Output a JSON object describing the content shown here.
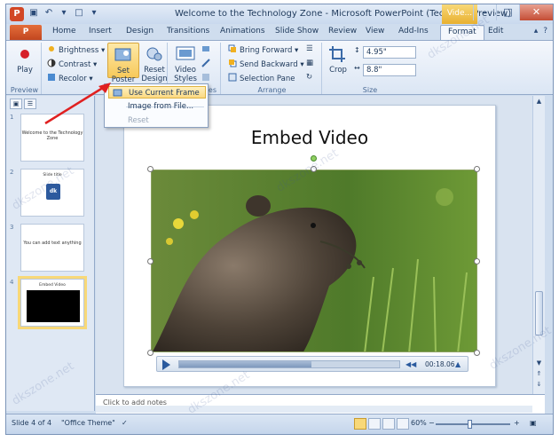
{
  "window": {
    "title": "Welcome to the Technology Zone - Microsoft PowerPoint (Technical Preview)",
    "context_tab": "Vide..."
  },
  "tabs": [
    "Home",
    "Insert",
    "Design",
    "Transitions",
    "Animations",
    "Slide Show",
    "Review",
    "View",
    "Add-Ins",
    "Format",
    "Edit"
  ],
  "file_tab": "P",
  "active_tab": "Format",
  "ribbon": {
    "preview": {
      "play_label": "Play",
      "group_label": "Preview"
    },
    "adjust": {
      "brightness": "Brightness",
      "contrast": "Contrast",
      "recolor": "Recolor",
      "set_poster_frame": "Set Poster Frame",
      "reset_design": "Reset Design"
    },
    "styles": {
      "video_styles": "Video Styles",
      "group_label": "les"
    },
    "arrange": {
      "bring_forward": "Bring Forward",
      "send_backward": "Send Backward",
      "selection_pane": "Selection Pane",
      "group_label": "Arrange"
    },
    "size": {
      "crop": "Crop",
      "height": "4.95\"",
      "width": "8.8\"",
      "group_label": "Size"
    }
  },
  "dropdown": {
    "items": [
      "Use Current Frame",
      "Image from File...",
      "Reset"
    ]
  },
  "slides": [
    {
      "num": "1",
      "text": "Welcome to the Technology Zone"
    },
    {
      "num": "2",
      "title": "Slide title",
      "logo": "dk"
    },
    {
      "num": "3",
      "text": "You can add text anything"
    },
    {
      "num": "4",
      "title": "Embed Video"
    }
  ],
  "slide": {
    "title": "Embed Video",
    "video_time": "00:18.06",
    "progress_fraction": 0.6
  },
  "notes": {
    "placeholder": "Click to add notes"
  },
  "status": {
    "slide": "Slide 4 of 4",
    "theme": "\"Office Theme\"",
    "zoom": "60%"
  },
  "watermark": "dkszone.net",
  "colors": {
    "accent": "#d24726",
    "context": "#f8d878",
    "highlight": "#fbd982"
  }
}
